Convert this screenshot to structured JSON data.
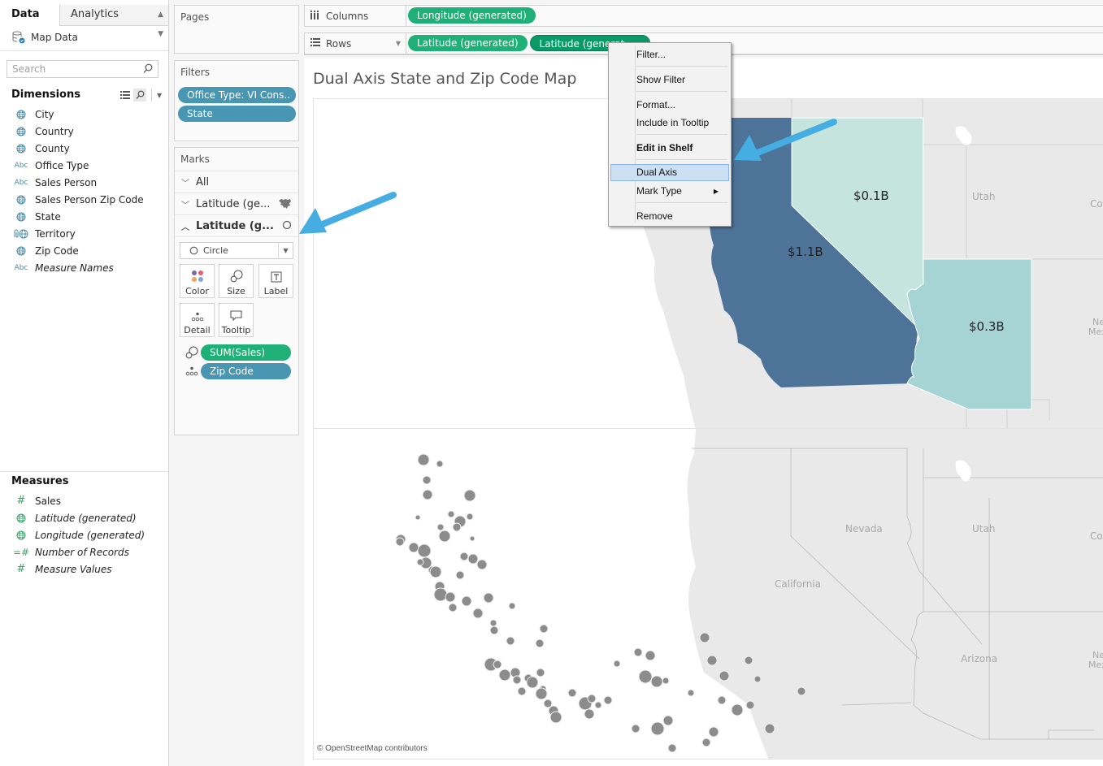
{
  "data_pane": {
    "tabs": [
      {
        "label": "Data",
        "active": true
      },
      {
        "label": "Analytics",
        "active": false
      }
    ],
    "datasource": {
      "name": "Map Data",
      "icon": "database-connected-icon"
    },
    "search": {
      "placeholder": "Search",
      "value": ""
    },
    "dimensions": {
      "title": "Dimensions",
      "fields": [
        {
          "name": "City",
          "icon": "globe-icon",
          "italic": false
        },
        {
          "name": "Country",
          "icon": "globe-icon",
          "italic": false
        },
        {
          "name": "County",
          "icon": "globe-icon",
          "italic": false
        },
        {
          "name": "Office Type",
          "icon": "abc-icon",
          "italic": false
        },
        {
          "name": "Sales Person",
          "icon": "abc-icon",
          "italic": false
        },
        {
          "name": "Sales Person Zip Code",
          "icon": "globe-icon",
          "italic": false
        },
        {
          "name": "State",
          "icon": "globe-icon",
          "italic": false
        },
        {
          "name": "Territory",
          "icon": "group-globe-icon",
          "italic": false
        },
        {
          "name": "Zip Code",
          "icon": "globe-icon",
          "italic": false
        },
        {
          "name": "Measure Names",
          "icon": "abc-icon",
          "italic": true
        }
      ]
    },
    "measures": {
      "title": "Measures",
      "fields": [
        {
          "name": "Sales",
          "icon": "hash-icon",
          "italic": false
        },
        {
          "name": "Latitude (generated)",
          "icon": "globe-icon",
          "italic": true
        },
        {
          "name": "Longitude (generated)",
          "icon": "globe-icon",
          "italic": true
        },
        {
          "name": "Number of Records",
          "icon": "calc-hash-icon",
          "italic": true
        },
        {
          "name": "Measure Values",
          "icon": "hash-icon",
          "italic": true
        }
      ]
    }
  },
  "pages": {
    "title": "Pages"
  },
  "filters": {
    "title": "Filters",
    "pills": [
      "Office Type: VI Cons..",
      "State"
    ]
  },
  "marks": {
    "title": "Marks",
    "layers": [
      {
        "label": "All",
        "expanded": false,
        "bold": false,
        "icon": ""
      },
      {
        "label": "Latitude (ge...",
        "expanded": false,
        "bold": false,
        "icon": "map-icon"
      },
      {
        "label": "Latitude (g...",
        "expanded": true,
        "bold": true,
        "icon": "circle-icon"
      }
    ],
    "mark_type": "Circle",
    "buttons": [
      "Color",
      "Size",
      "Label",
      "Detail",
      "Tooltip"
    ],
    "encodings": [
      {
        "field": "SUM(Sales)",
        "type": "size",
        "color": "green"
      },
      {
        "field": "Zip Code",
        "type": "detail",
        "color": "blue"
      }
    ]
  },
  "shelves": {
    "columns": {
      "label": "Columns",
      "pills": [
        "Longitude (generated)"
      ]
    },
    "rows": {
      "label": "Rows",
      "pills": [
        "Latitude (generated)",
        "Latitude (generat..."
      ]
    }
  },
  "viz": {
    "title": "Dual Axis State and Zip Code Map",
    "attribution": "© OpenStreetMap contributors",
    "top_map": {
      "state_labels": [
        {
          "state": "California",
          "value": "$1.1B"
        },
        {
          "state": "Nevada",
          "value": "$0.1B"
        },
        {
          "state": "Arizona",
          "value": "$0.3B"
        }
      ],
      "base_labels": [
        "Utah",
        "Col",
        "New Mexi"
      ]
    },
    "bottom_map": {
      "base_labels": [
        "Nevada",
        "Utah",
        "California",
        "Arizona",
        "Col",
        "New Mexi"
      ]
    },
    "colors": {
      "california": "#4e7399",
      "nevada": "#c4e4dd",
      "arizona": "#a6d4d5",
      "land": "#e8e8e8",
      "circle": "#8c8c8c"
    }
  },
  "context_menu": {
    "items": [
      {
        "label": "Filter...",
        "bold": false,
        "highlighted": false,
        "submenu": false
      },
      {
        "label": "Show Filter",
        "bold": false,
        "highlighted": false,
        "submenu": false
      },
      {
        "label": "Format...",
        "bold": false,
        "highlighted": false,
        "submenu": false
      },
      {
        "label": "Include in Tooltip",
        "bold": false,
        "highlighted": false,
        "submenu": false
      },
      {
        "label": "Edit in Shelf",
        "bold": true,
        "highlighted": false,
        "submenu": false
      },
      {
        "label": "Dual Axis",
        "bold": false,
        "highlighted": true,
        "submenu": false
      },
      {
        "label": "Mark Type",
        "bold": false,
        "highlighted": false,
        "submenu": true
      },
      {
        "label": "Remove",
        "bold": false,
        "highlighted": false,
        "submenu": false
      }
    ]
  },
  "annotations": {
    "arrow_color": "#45ade2"
  }
}
